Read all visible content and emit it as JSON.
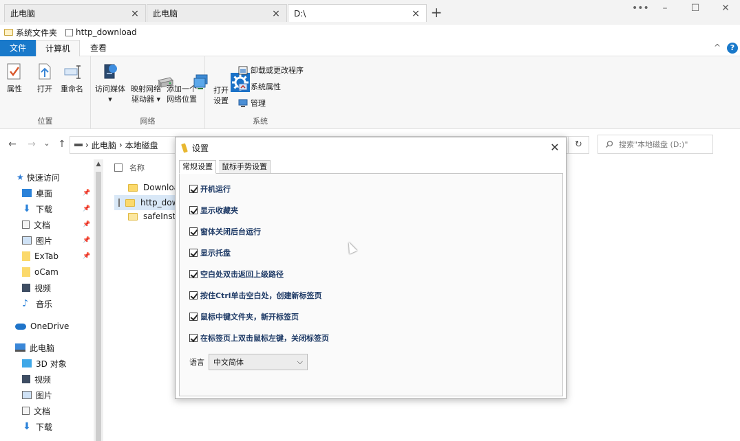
{
  "tabs": [
    {
      "label": "此电脑",
      "close": "×"
    },
    {
      "label": "此电脑",
      "close": "×"
    },
    {
      "label": "D:\\",
      "close": "×"
    }
  ],
  "window_controls": {
    "more": "•••",
    "minimize": "–",
    "maximize": "☐",
    "close": "✕",
    "new_tab": "+"
  },
  "bookmarks": [
    {
      "label": "系统文件夹",
      "icon": "folder-icon"
    },
    {
      "label": "http_download",
      "icon": "page-icon"
    }
  ],
  "ribbon_tabs": {
    "file": "文件",
    "computer": "计算机",
    "view": "查看"
  },
  "ribbon_collapse": "^",
  "ribbon_help": "?",
  "ribbon": {
    "location_group": {
      "name": "位置",
      "buttons": [
        {
          "label": "属性",
          "icon": "properties-icon"
        },
        {
          "label": "打开",
          "icon": "open-icon"
        },
        {
          "label": "重命名",
          "icon": "rename-icon"
        }
      ]
    },
    "network_group": {
      "name": "网络",
      "buttons": [
        {
          "label": "访问媒体",
          "icon": "media-icon",
          "arrow": "▾"
        },
        {
          "label": "映射网络\n驱动器 ▾",
          "icon": "map-drive-icon"
        },
        {
          "label": "添加一个\n网络位置",
          "icon": "network-location-icon"
        }
      ]
    },
    "system_group": {
      "name": "系统",
      "open_settings": "打开\n设置",
      "small": [
        {
          "label": "卸载或更改程序",
          "icon": "uninstall-icon"
        },
        {
          "label": "系统属性",
          "icon": "system-properties-icon"
        },
        {
          "label": "管理",
          "icon": "manage-icon"
        }
      ]
    }
  },
  "address": {
    "separator": "›",
    "crumbs": [
      "此电脑",
      "本地磁盘"
    ],
    "refresh": "↻"
  },
  "search": {
    "placeholder": "搜索\"本地磁盘 (D:)\"",
    "icon": "search-icon"
  },
  "nav_buttons": {
    "back": "←",
    "forward": "→",
    "recent": "⌄",
    "up": "↑"
  },
  "nav_pane": {
    "quick_access": "快速访问",
    "quick_items": [
      {
        "label": "桌面",
        "icon": "desktop-icon",
        "pinned": true
      },
      {
        "label": "下载",
        "icon": "download-icon",
        "pinned": true
      },
      {
        "label": "文档",
        "icon": "documents-icon",
        "pinned": true
      },
      {
        "label": "图片",
        "icon": "pictures-icon",
        "pinned": true
      },
      {
        "label": "ExTab",
        "icon": "folder-icon",
        "pinned": true
      },
      {
        "label": "oCam",
        "icon": "folder-icon",
        "pinned": false
      },
      {
        "label": "视频",
        "icon": "videos-icon",
        "pinned": false
      },
      {
        "label": "音乐",
        "icon": "music-icon",
        "pinned": false
      }
    ],
    "onedrive": "OneDrive",
    "this_pc": "此电脑",
    "pc_items": [
      {
        "label": "3D 对象",
        "icon": "3d-objects-icon"
      },
      {
        "label": "视频",
        "icon": "videos-icon"
      },
      {
        "label": "图片",
        "icon": "pictures-icon"
      },
      {
        "label": "文档",
        "icon": "documents-icon"
      },
      {
        "label": "下载",
        "icon": "download-icon"
      }
    ]
  },
  "file_list": {
    "header_name": "名称",
    "rows": [
      {
        "name": "Download",
        "selected": false
      },
      {
        "name": "http_download",
        "selected": true
      },
      {
        "name": "safeInstall",
        "selected": false
      }
    ]
  },
  "dialog": {
    "title": "设置",
    "close": "✕",
    "tabs": [
      "常规设置",
      "鼠标手势设置"
    ],
    "options": [
      {
        "label": "开机运行",
        "checked": true
      },
      {
        "label": "显示收藏夹",
        "checked": true
      },
      {
        "label": "窗体关闭后台运行",
        "checked": true
      },
      {
        "label": "显示托盘",
        "checked": true
      },
      {
        "label": "空白处双击返回上级路径",
        "checked": true
      },
      {
        "label": "按住Ctrl单击空白处，创建新标签页",
        "checked": true
      },
      {
        "label": "鼠标中键文件夹，新开标签页",
        "checked": true
      },
      {
        "label": "在标签页上双击鼠标左键，关闭标签页",
        "checked": true
      }
    ],
    "language_label": "语言",
    "language_value": "中文简体",
    "language_arrow": "⌵"
  },
  "colors": {
    "accent": "#1979ca",
    "folder": "#fbd96b",
    "option_text": "#1e3a66"
  }
}
